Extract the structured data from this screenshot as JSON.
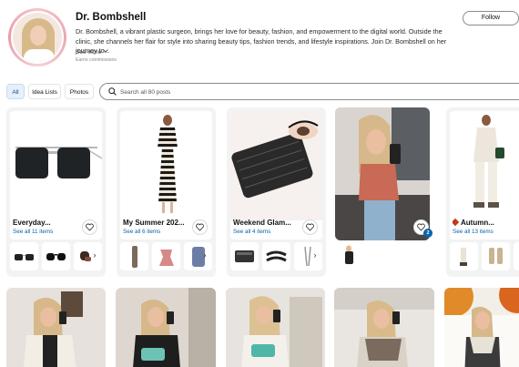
{
  "profile": {
    "name": "Dr. Bombshell",
    "bio": "Dr. Bombshell, a vibrant plastic surgeon, brings her love for beauty, fashion, and empowerment to the digital world. Outside the clinic, she channels her flair for style into sharing beauty tips, fashion trends, and lifestyle inspirations. Join Dr. Bombshell on her journey to...",
    "see_more": "See more",
    "commission_note": "Earns commissions",
    "follow_label": "Follow"
  },
  "tabs": [
    {
      "label": "All",
      "active": true
    },
    {
      "label": "Idea Lists",
      "active": false
    },
    {
      "label": "Photos",
      "active": false
    }
  ],
  "search": {
    "placeholder": "Search all 80 posts",
    "value": ""
  },
  "cards": [
    {
      "title": "Everyday...",
      "see_all": "See all 11 items",
      "image": "sunglasses",
      "thumbs": [
        "sunglasses",
        "sunglasses",
        "sunglasses"
      ]
    },
    {
      "title": "My Summer 202...",
      "see_all": "See all 6 items",
      "image": "striped-dress",
      "thumbs": [
        "dress",
        "top",
        "dress"
      ]
    },
    {
      "title": "Weekend Glam...",
      "see_all": "See all 4 items",
      "image": "false-lashes",
      "thumbs": [
        "lash-kit",
        "lash-strip",
        "lash-tool"
      ]
    },
    {
      "title": "",
      "see_all": "",
      "image": "selfie-photo",
      "badge": "2",
      "thumbs": [
        "outfit"
      ]
    },
    {
      "title": "Autumn...",
      "see_all": "See all 13 items",
      "image": "autumn-outfit",
      "thumbs": [
        "shoes",
        "boots",
        "boots"
      ]
    }
  ],
  "photos": [
    {
      "label": "mirror-selfie-white-jacket"
    },
    {
      "label": "mirror-selfie-black-outfit"
    },
    {
      "label": "mirror-selfie-turquoise-bag"
    },
    {
      "label": "mirror-selfie-plaid-scarf"
    },
    {
      "label": "autumn-porch-photo"
    }
  ],
  "colors": {
    "link": "#0a63a8",
    "active_tab_bg": "#e6f0fa",
    "card_bg": "#f2f3f3",
    "badge": "#0a63a8"
  },
  "icons": {
    "search": "search-icon",
    "heart": "heart-icon",
    "chevron": "chevron-right-icon",
    "see_more_chevron": "chevron-down-icon"
  }
}
